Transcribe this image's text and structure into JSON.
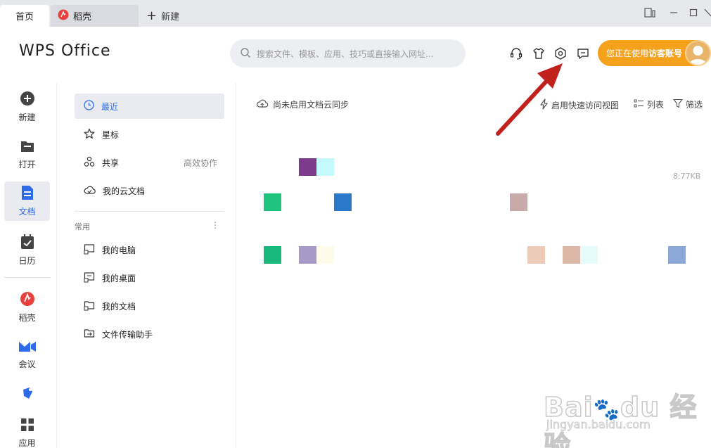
{
  "tabs": {
    "home": "首页",
    "daoke": "稻壳",
    "new": "新建"
  },
  "header": {
    "logo": "WPS Office",
    "search_placeholder": "搜索文件、模板、应用、技巧或直接输入网址...",
    "account_prefix": "您正在使用",
    "account_name": "访客账号"
  },
  "rail": {
    "new": "新建",
    "open": "打开",
    "docs": "文档",
    "calendar": "日历",
    "daoke": "稻壳",
    "meeting": "会议",
    "apps": "应用"
  },
  "nav": {
    "recent": "最近",
    "starred": "星标",
    "shared": "共享",
    "shared_extra": "高效协作",
    "cloud_docs": "我的云文档",
    "section_common": "常用",
    "my_computer": "我的电脑",
    "my_desktop": "我的桌面",
    "my_documents": "我的文档",
    "file_transfer": "文件传输助手"
  },
  "content": {
    "cloud_sync": "尚未启用文档云同步",
    "quick_view": "启用快速访问视图",
    "list": "列表",
    "filter": "筛选",
    "file_size": "8.77KB"
  },
  "colors": {
    "accent": "#2f6ae8",
    "account_bg": "#f4a21c",
    "arrow": "#c0211d"
  },
  "icons": {
    "support": "headset-icon",
    "skin": "tshirt-icon",
    "settings": "gear-icon",
    "feedback": "message-icon"
  }
}
